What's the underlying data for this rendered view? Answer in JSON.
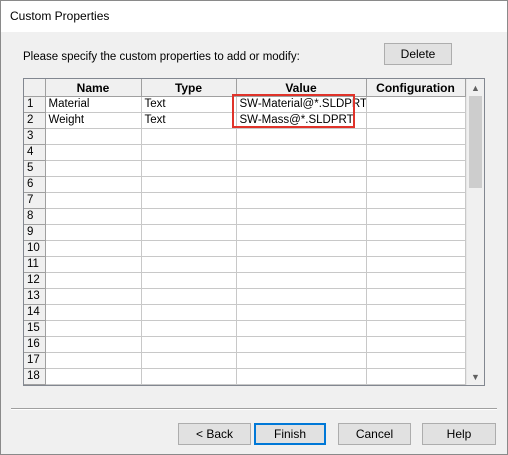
{
  "window": {
    "title": "Custom Properties"
  },
  "instruction": "Please specify the custom properties to add or modify:",
  "buttons": {
    "delete": "Delete",
    "back": "< Back",
    "finish": "Finish",
    "cancel": "Cancel",
    "help": "Help"
  },
  "grid": {
    "columns": [
      "Name",
      "Type",
      "Value",
      "Configuration"
    ],
    "rows": [
      {
        "num": "1",
        "name": "Material",
        "type": "Text",
        "value": "SW-Material@*.SLDPRT",
        "configuration": ""
      },
      {
        "num": "2",
        "name": "Weight",
        "type": "Text",
        "value": "SW-Mass@*.SLDPRT",
        "configuration": ""
      },
      {
        "num": "3",
        "name": "",
        "type": "",
        "value": "",
        "configuration": ""
      },
      {
        "num": "4",
        "name": "",
        "type": "",
        "value": "",
        "configuration": ""
      },
      {
        "num": "5",
        "name": "",
        "type": "",
        "value": "",
        "configuration": ""
      },
      {
        "num": "6",
        "name": "",
        "type": "",
        "value": "",
        "configuration": ""
      },
      {
        "num": "7",
        "name": "",
        "type": "",
        "value": "",
        "configuration": ""
      },
      {
        "num": "8",
        "name": "",
        "type": "",
        "value": "",
        "configuration": ""
      },
      {
        "num": "9",
        "name": "",
        "type": "",
        "value": "",
        "configuration": ""
      },
      {
        "num": "10",
        "name": "",
        "type": "",
        "value": "",
        "configuration": ""
      },
      {
        "num": "11",
        "name": "",
        "type": "",
        "value": "",
        "configuration": ""
      },
      {
        "num": "12",
        "name": "",
        "type": "",
        "value": "",
        "configuration": ""
      },
      {
        "num": "13",
        "name": "",
        "type": "",
        "value": "",
        "configuration": ""
      },
      {
        "num": "14",
        "name": "",
        "type": "",
        "value": "",
        "configuration": ""
      },
      {
        "num": "15",
        "name": "",
        "type": "",
        "value": "",
        "configuration": ""
      },
      {
        "num": "16",
        "name": "",
        "type": "",
        "value": "",
        "configuration": ""
      },
      {
        "num": "17",
        "name": "",
        "type": "",
        "value": "",
        "configuration": ""
      },
      {
        "num": "18",
        "name": "",
        "type": "",
        "value": "",
        "configuration": ""
      }
    ]
  },
  "scrollbar": {
    "up_icon": "chevron-up-icon",
    "down_icon": "chevron-down-icon"
  },
  "colors": {
    "highlight": "#e0332a",
    "default_button_border": "#0078d7"
  }
}
